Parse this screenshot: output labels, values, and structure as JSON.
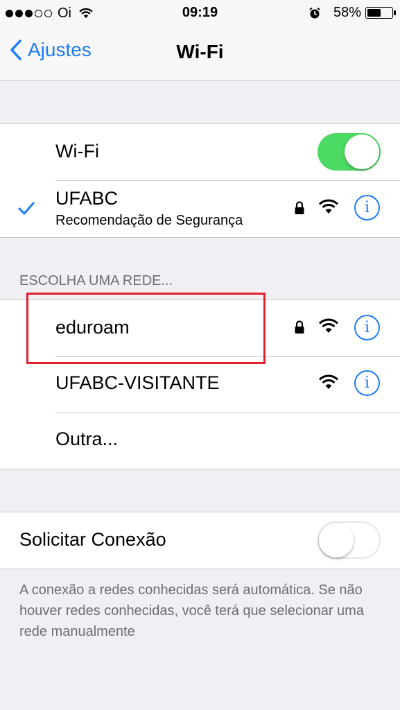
{
  "status_bar": {
    "carrier": "Oi",
    "time": "09:19",
    "battery_percent": "58%",
    "battery_level": 0.58,
    "signal_bars_filled": 3,
    "signal_bars_total": 5
  },
  "nav": {
    "back_label": "Ajustes",
    "title": "Wi-Fi"
  },
  "wifi": {
    "label": "Wi-Fi",
    "enabled": true
  },
  "connected_network": {
    "name": "UFABC",
    "subtitle": "Recomendação de Segurança",
    "secured": true,
    "icons": [
      "checkmark-icon",
      "lock-icon",
      "wifi-signal-icon",
      "info-icon"
    ]
  },
  "networks_section": {
    "header": "ESCOLHA UMA REDE...",
    "networks": [
      {
        "name": "eduroam",
        "secured": true,
        "highlighted": true
      },
      {
        "name": "UFABC-VISITANTE",
        "secured": false
      },
      {
        "name": "Outra..."
      }
    ]
  },
  "ask_to_join": {
    "label": "Solicitar Conexão",
    "enabled": false,
    "footer": "A conexão a redes conhecidas será automática. Se não houver redes conhecidas, você terá que selecionar uma rede manualmente"
  },
  "colors": {
    "accent": "#1a7cf5",
    "toggle_on": "#4cd964",
    "highlight_box": "#e0212c",
    "background": "#efeff4"
  }
}
